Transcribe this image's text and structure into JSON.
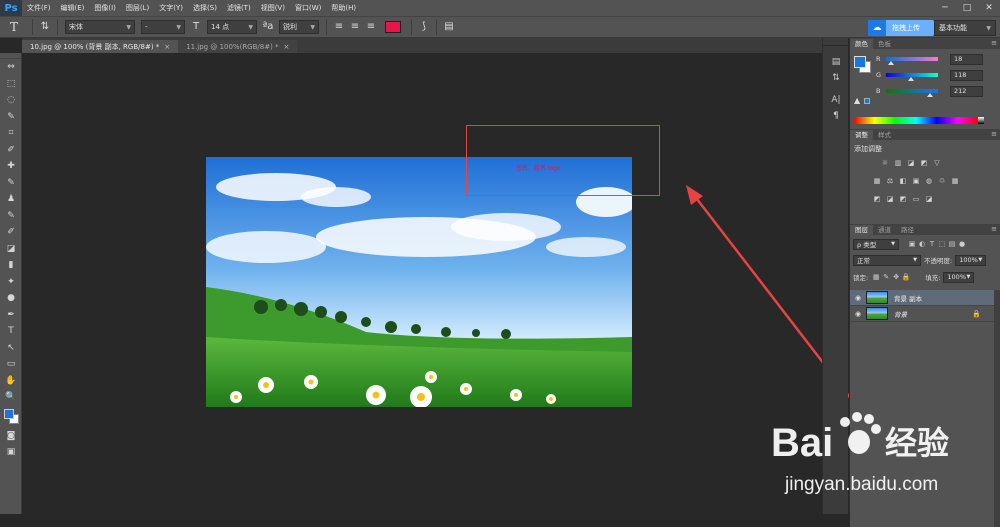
{
  "app": {
    "logo": "Ps",
    "menu": [
      "文件(F)",
      "编辑(E)",
      "图像(I)",
      "图层(L)",
      "文字(Y)",
      "选择(S)",
      "滤镜(T)",
      "视图(V)",
      "窗口(W)",
      "帮助(H)"
    ],
    "window_controls": [
      "─",
      "□",
      "✕"
    ]
  },
  "options_bar": {
    "tool_glyph": "T",
    "orient_glyph": "⇅",
    "font_family": "宋体",
    "font_style": "-",
    "size_glyph": "T",
    "font_size": "14 点",
    "aa_glyph": "ªa",
    "antialias": "锐利",
    "align_glyphs": [
      "≡",
      "≡",
      "≡"
    ],
    "text_color": "#e8154a",
    "warp_glyph": "⟆",
    "panel_glyph": "▤",
    "cloud_button": "拖拽上传",
    "workspace": "基本功能"
  },
  "doc_tabs": [
    {
      "label": "10.jpg @ 100% (背景 副本, RGB/8#) *",
      "active": true
    },
    {
      "label": "11.jpg @ 100%(RGB/8#) *",
      "active": false
    }
  ],
  "tools": [
    "⇔",
    "⬚",
    "◌",
    "✎",
    "⌗",
    "✐",
    "✚",
    "✎",
    "♟",
    "✎",
    "✐",
    "◪",
    "▮",
    "✦",
    "●",
    "✒",
    "T",
    "↖",
    "▭",
    "✋",
    "🔍"
  ],
  "canvas": {
    "annotation_text": "签名、姓名 logo",
    "annotation_color": "#e84343"
  },
  "color_panel": {
    "tabs": [
      "颜色",
      "色板"
    ],
    "r_label": "R",
    "g_label": "G",
    "b_label": "B",
    "r": "18",
    "g": "118",
    "b": "212",
    "foreground": "#1276d4"
  },
  "adjust_panel": {
    "tabs": [
      "调整",
      "样式"
    ],
    "title": "添加调整"
  },
  "layers_panel": {
    "tabs": [
      "图层",
      "通道",
      "路径"
    ],
    "kind_label": "ρ 类型",
    "blend_mode": "正常",
    "opacity_label": "不透明度:",
    "opacity": "100%",
    "lock_label": "锁定:",
    "fill_label": "填充:",
    "fill": "100%",
    "layers": [
      {
        "name": "背景 副本",
        "selected": true,
        "locked": false
      },
      {
        "name": "背景",
        "selected": false,
        "locked": true
      }
    ]
  },
  "watermark": {
    "brand_left": "Bai",
    "brand_right": "经验",
    "url": "jingyan.baidu.com"
  }
}
